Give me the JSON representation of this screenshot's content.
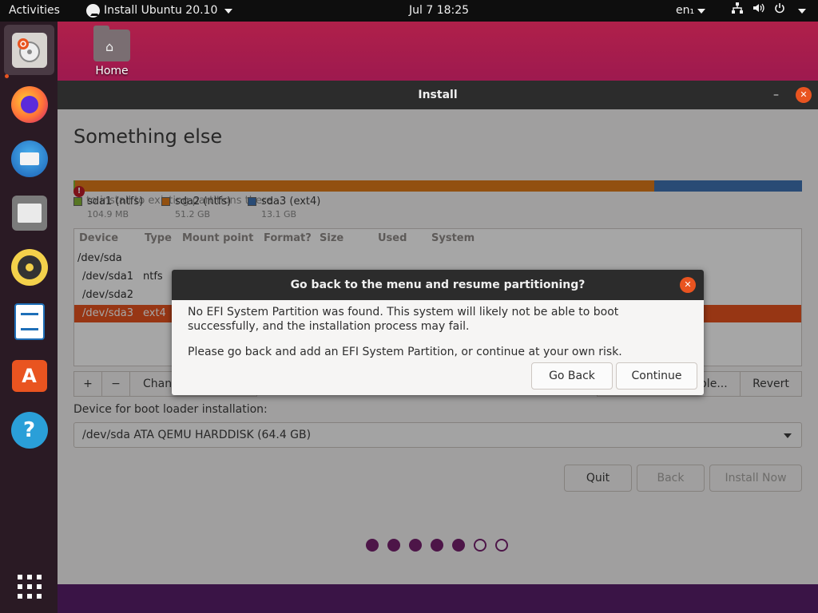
{
  "topbar": {
    "activities": "Activities",
    "app_name": "Install Ubuntu 20.10",
    "clock": "Jul 7  18:25",
    "language": "en₁"
  },
  "desktop": {
    "home_label": "Home"
  },
  "dock": {
    "items": [
      "ubuntu-installer-icon",
      "firefox-icon",
      "thunderbird-icon",
      "files-icon",
      "rhythmbox-icon",
      "libreoffice-writer-icon",
      "software-center-icon",
      "help-icon",
      "show-applications-icon"
    ]
  },
  "window": {
    "title": "Install",
    "heading": "Something else",
    "warning_text": "to install to existing partitions there...",
    "partition_bar": [
      {
        "name": "sda1 (ntfs)",
        "size": "104.9 MB",
        "color": "#86b537",
        "fraction": 0.002
      },
      {
        "name": "sda2 (ntfs)",
        "size": "51.2 GB",
        "color": "#e07b19",
        "fraction": 0.795
      },
      {
        "name": "sda3 (ext4)",
        "size": "13.1 GB",
        "color": "#3f74b4",
        "fraction": 0.203
      }
    ],
    "table": {
      "headers": [
        "Device",
        "Type",
        "Mount point",
        "Format?",
        "Size",
        "Used",
        "System"
      ],
      "rows": [
        {
          "device": "/dev/sda",
          "type": ""
        },
        {
          "device": "/dev/sda1",
          "type": "ntfs"
        },
        {
          "device": "/dev/sda2",
          "type": ""
        },
        {
          "device": "/dev/sda3",
          "type": "ext4",
          "selected": true
        }
      ]
    },
    "tools": {
      "add": "+",
      "remove": "−",
      "change": "Change...",
      "new_table": "New Partition Table...",
      "revert": "Revert"
    },
    "bootloader_label": "Device for boot loader installation:",
    "bootloader_value": "/dev/sda   ATA QEMU HARDDISK (64.4 GB)",
    "buttons": {
      "quit": "Quit",
      "back": "Back",
      "install": "Install Now"
    },
    "progress_steps": {
      "completed": 5,
      "total": 7
    }
  },
  "dialog": {
    "title": "Go back to the menu and resume partitioning?",
    "message": "No EFI System Partition was found. This system will likely not be able to boot successfully, and the installation process may fail.",
    "message2": "Please go back and add an EFI System Partition, or continue at your own risk.",
    "go_back": "Go Back",
    "continue": "Continue"
  }
}
